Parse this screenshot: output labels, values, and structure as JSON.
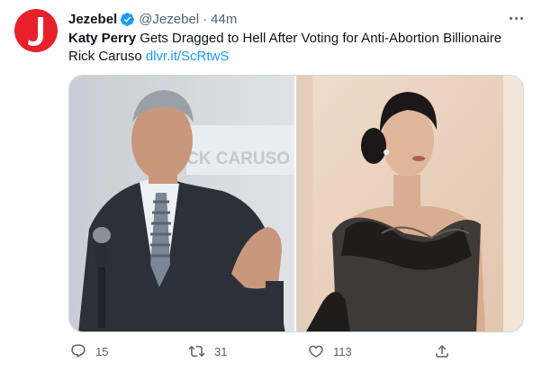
{
  "author": {
    "display_name": "Jezebel",
    "handle": "@Jezebel",
    "separator": "·",
    "time": "44m",
    "verified": true,
    "avatar_letter": "J",
    "brand_color": "#e8202a"
  },
  "tweet": {
    "text_bold": "Katy Perry",
    "text_rest": " Gets Dragged to Hell After Voting for Anti-Abortion Billionaire Rick Caruso ",
    "link": "dlvr.it/ScRtwS",
    "link_color": "#1d9bf0"
  },
  "media": {
    "left_photo": {
      "backdrop_text": "CK CARUSO F"
    },
    "right_photo": {}
  },
  "actions": {
    "reply_count": "15",
    "retweet_count": "31",
    "like_count": "113",
    "icons": [
      "reply-icon",
      "retweet-icon",
      "like-icon",
      "share-icon"
    ]
  },
  "colors": {
    "text": "#0f1419",
    "muted": "#536471",
    "verified": "#1d9bf0",
    "border": "#cfd9de"
  }
}
